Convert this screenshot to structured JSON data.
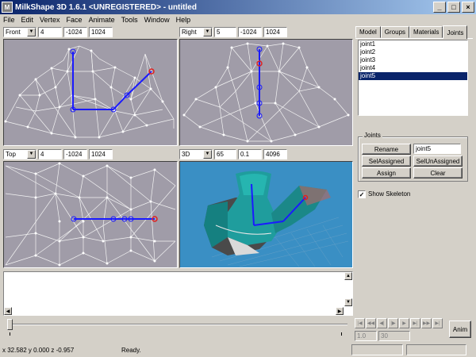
{
  "app": {
    "title": "MilkShape 3D 1.6.1 <UNREGISTERED> - untitled",
    "icon_glyph": "M"
  },
  "window_controls": {
    "minimize": "_",
    "maximize": "□",
    "close": "×"
  },
  "menu": [
    "File",
    "Edit",
    "Vertex",
    "Face",
    "Animate",
    "Tools",
    "Window",
    "Help"
  ],
  "viewports": {
    "front": {
      "view": "Front",
      "a": "4",
      "b": "-1024",
      "c": "1024"
    },
    "right": {
      "view": "Right",
      "a": "5",
      "b": "-1024",
      "c": "1024"
    },
    "top": {
      "view": "Top",
      "a": "4",
      "b": "-1024",
      "c": "1024"
    },
    "persp": {
      "view": "3D",
      "a": "65",
      "b": "0.1",
      "c": "4096"
    }
  },
  "tabs": [
    "Model",
    "Groups",
    "Materials",
    "Joints"
  ],
  "active_tab": "Joints",
  "joints_list": [
    "joint1",
    "joint2",
    "joint3",
    "joint4",
    "joint5"
  ],
  "selected_joint": "joint5",
  "joints_panel": {
    "group_label": "Joints",
    "rename_label": "Rename",
    "name_value": "joint5",
    "sel_assigned": "SelAssigned",
    "sel_unassigned": "SelUnAssigned",
    "assign": "Assign",
    "clear": "Clear",
    "show_skeleton_label": "Show Skeleton",
    "show_skeleton_checked": "✓"
  },
  "anim": {
    "start_frame": "1.0",
    "end_frame": "30",
    "anim_button": "Anim",
    "controls": [
      "|◀",
      "◀◀",
      "◀|",
      "|▶",
      "▶",
      "▶|",
      "▶▶",
      "▶|"
    ]
  },
  "status": {
    "coords": "x 32.582 y 0.000 z -0.957",
    "message": "Ready."
  },
  "colors": {
    "titlebar_start": "#0a246a",
    "viewport_bg": "#a09ca8",
    "viewport_3d_bg": "#3a8fc4",
    "skeleton": "#1a1aff",
    "joint_selected": "#e02020"
  }
}
